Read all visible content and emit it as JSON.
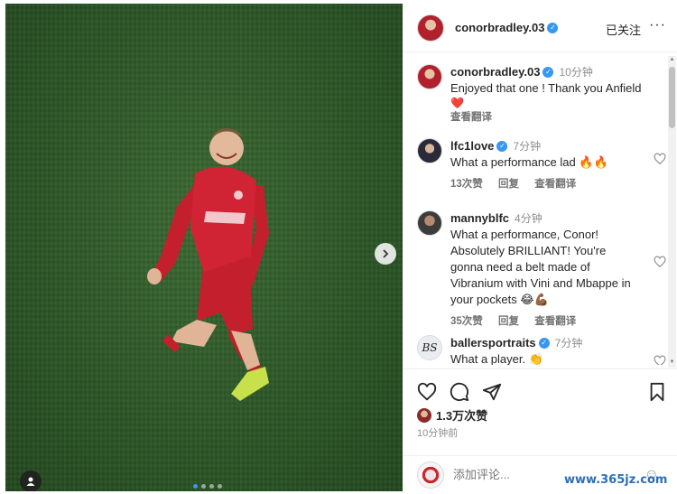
{
  "post": {
    "author": "conorbradley.03",
    "follow_status": "已关注",
    "more_icon": "more-horizontal-icon",
    "media_dots": 4,
    "active_dot": 1
  },
  "caption": {
    "author": "conorbradley.03",
    "time": "10分钟",
    "text": "Enjoyed that one ! Thank you Anfield",
    "emoji": "❤️",
    "translate": "查看翻译"
  },
  "comments": [
    {
      "author": "lfc1love",
      "verified": true,
      "time": "7分钟",
      "text": "What a performance lad 🔥🔥",
      "likes": "13次赞",
      "reply": "回复",
      "translate": "查看翻译"
    },
    {
      "author": "mannyblfc",
      "verified": false,
      "time": "4分钟",
      "text": "What a performance, Conor! Absolutely BRILLIANT! You're gonna need a belt made of Vibranium with Vini and Mbappe in your pockets 😂💪🏾",
      "likes": "35次赞",
      "reply": "回复",
      "translate": "查看翻译"
    },
    {
      "author": "ballersportraits",
      "verified": true,
      "time": "7分钟",
      "text": "What a player. 👏",
      "avatar_text": "BS"
    }
  ],
  "actions": {
    "like_icon": "heart-icon",
    "comment_icon": "comment-icon",
    "share_icon": "send-icon",
    "save_icon": "bookmark-icon"
  },
  "likes_count": "1.3万次赞",
  "post_time": "10分钟前",
  "add_comment": {
    "placeholder": "添加评论..."
  },
  "watermark": "www.365jz.com",
  "colors": {
    "verified": "#3897f0",
    "kit_red": "#c8202e",
    "pitch": "#2f5a29",
    "active_dot": "#3d95f0"
  }
}
